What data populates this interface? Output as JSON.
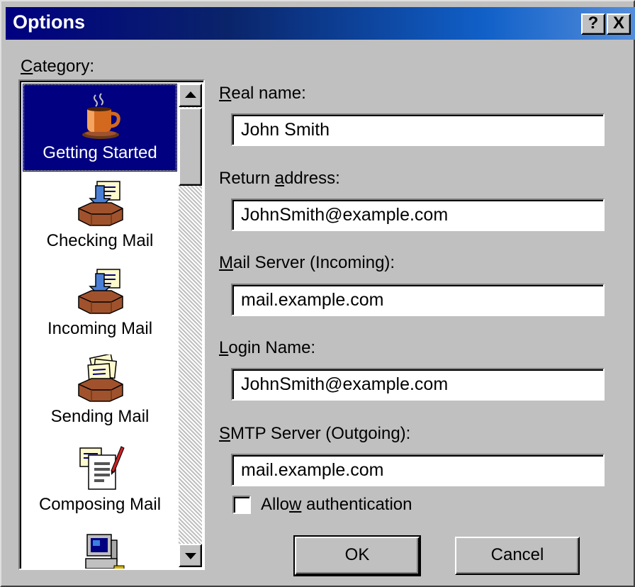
{
  "window": {
    "title": "Options",
    "help_button": "?",
    "close_button": "X"
  },
  "category": {
    "label_accel": "C",
    "label_rest": "ategory:",
    "items": [
      {
        "label": "Getting Started",
        "icon": "coffee-cup-icon",
        "selected": true
      },
      {
        "label": "Checking Mail",
        "icon": "inbox-tray-icon",
        "selected": false
      },
      {
        "label": "Incoming Mail",
        "icon": "inbox-tray-icon",
        "selected": false
      },
      {
        "label": "Sending Mail",
        "icon": "outbox-tray-icon",
        "selected": false
      },
      {
        "label": "Composing Mail",
        "icon": "compose-document-icon",
        "selected": false
      },
      {
        "label": "",
        "icon": "computer-icon",
        "selected": false
      }
    ]
  },
  "fields": {
    "real_name": {
      "label_accel": "R",
      "label_rest": "eal name:",
      "value": "John Smith"
    },
    "return_address": {
      "label_pre": "Return ",
      "label_accel": "a",
      "label_rest": "ddress:",
      "value": "JohnSmith@example.com"
    },
    "mail_server": {
      "label_accel": "M",
      "label_rest": "ail Server (Incoming):",
      "value": "mail.example.com"
    },
    "login_name": {
      "label_accel": "L",
      "label_rest": "ogin Name:",
      "value": "JohnSmith@example.com"
    },
    "smtp_server": {
      "label_accel": "S",
      "label_rest": "MTP Server (Outgoing):",
      "value": "mail.example.com"
    }
  },
  "auth": {
    "label_pre": "Allo",
    "label_accel": "w",
    "label_rest": " authentication",
    "checked": false
  },
  "buttons": {
    "ok": "OK",
    "cancel": "Cancel"
  },
  "colors": {
    "face": "#c0c0c0",
    "title_start": "#000080",
    "title_end": "#5890dc",
    "selection": "#000080"
  }
}
